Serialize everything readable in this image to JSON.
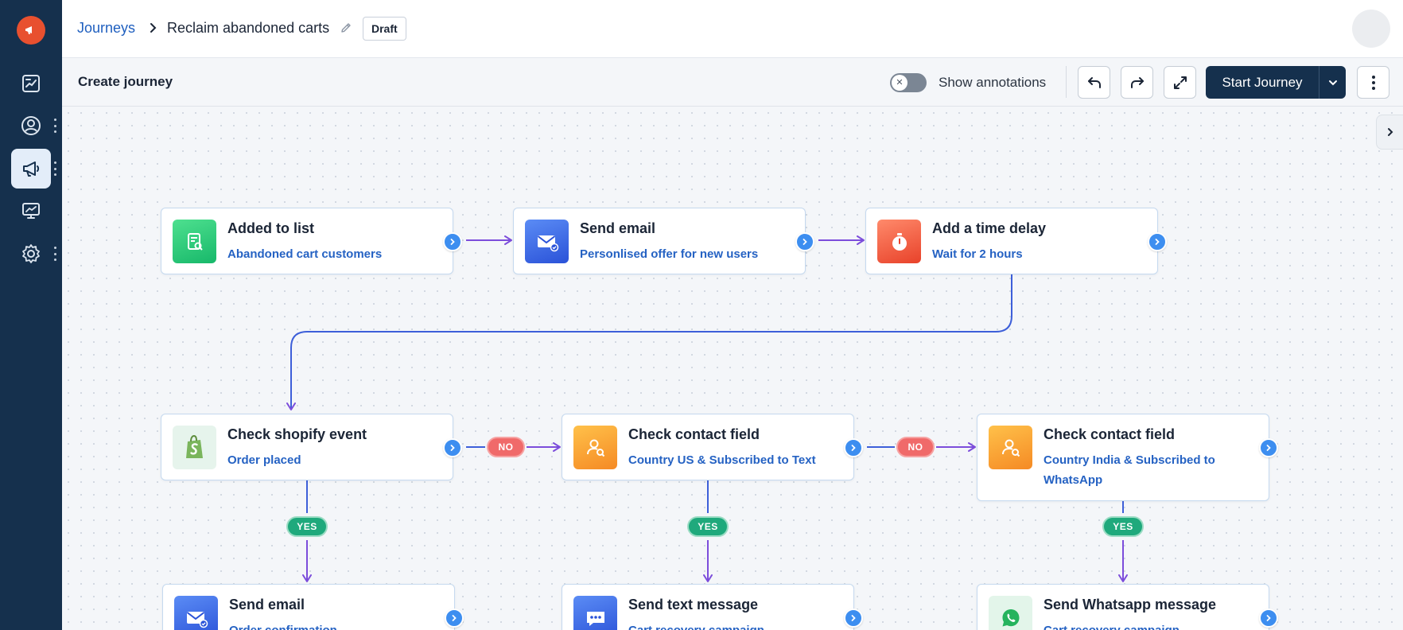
{
  "app": {
    "brand_color": "#e8502f",
    "sidebar_color": "#15304d",
    "accent_color": "#3d8ef0"
  },
  "sidebar": {
    "items": [
      {
        "icon": "report-icon"
      },
      {
        "icon": "contacts-icon"
      },
      {
        "icon": "megaphone-icon",
        "active": true
      },
      {
        "icon": "monitor-icon"
      },
      {
        "icon": "settings-icon"
      }
    ]
  },
  "header": {
    "breadcrumb_root": "Journeys",
    "journey_title": "Reclaim abandoned carts",
    "status_badge": "Draft"
  },
  "toolbar": {
    "title": "Create journey",
    "annotations_label": "Show annotations",
    "annotations_on": false,
    "start_label": "Start Journey"
  },
  "nodes": [
    {
      "title": "Added to list",
      "subtitle": "Abandoned cart customers",
      "icon": "list-search-icon"
    },
    {
      "title": "Send email",
      "subtitle": "Personlised offer for new users",
      "icon": "email-icon"
    },
    {
      "title": "Add a time delay",
      "subtitle": "Wait for 2 hours",
      "icon": "stopwatch-icon"
    },
    {
      "title": "Check shopify event",
      "subtitle": "Order placed",
      "icon": "shopify-icon"
    },
    {
      "title": "Check contact field",
      "subtitle": "Country US & Subscribed to Text",
      "icon": "contact-search-icon"
    },
    {
      "title": "Check contact field",
      "subtitle": "Country India & Subscribed to WhatsApp",
      "icon": "contact-search-icon"
    },
    {
      "title": "Send email",
      "subtitle": "Order confirmation",
      "icon": "email-icon"
    },
    {
      "title": "Send text message",
      "subtitle": "Cart recovery campaign",
      "icon": "chat-icon"
    },
    {
      "title": "Send Whatsapp message",
      "subtitle": "Cart recovery campaign",
      "icon": "whatsapp-icon"
    }
  ],
  "branch_labels": {
    "no": "NO",
    "yes": "YES"
  }
}
